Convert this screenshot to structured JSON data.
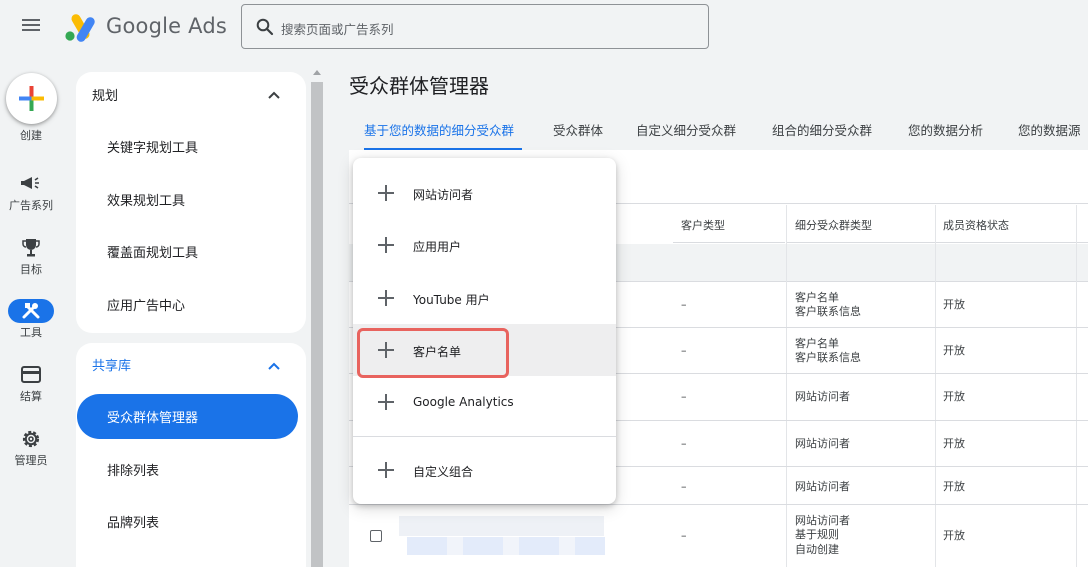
{
  "header": {
    "brand_name": "Google Ads",
    "search_placeholder": "搜索页面或广告系列"
  },
  "rail": {
    "create_label": "创建",
    "items": [
      {
        "label": "广告系列",
        "icon": "megaphone-icon"
      },
      {
        "label": "目标",
        "icon": "trophy-icon"
      },
      {
        "label": "工具",
        "icon": "tools-icon",
        "active": true
      },
      {
        "label": "结算",
        "icon": "credit-card-icon"
      },
      {
        "label": "管理员",
        "icon": "gear-icon"
      }
    ]
  },
  "sidebar": {
    "planning": {
      "title": "规划",
      "items": [
        "关键字规划工具",
        "效果规划工具",
        "覆盖面规划工具",
        "应用广告中心"
      ]
    },
    "shared_library": {
      "title": "共享库",
      "active_item": "受众群体管理器",
      "items": [
        "排除列表",
        "品牌列表"
      ]
    }
  },
  "page": {
    "title": "受众群体管理器",
    "tabs": [
      "基于您的数据的细分受众群",
      "受众群体",
      "自定义细分受众群",
      "组合的细分受众群",
      "您的数据分析",
      "您的数据源"
    ]
  },
  "table": {
    "columns": [
      "客户类型",
      "细分受众群类型",
      "成员资格状态"
    ],
    "rows": [
      {
        "customer_type": "–",
        "segment_type": [
          "客户名单",
          "客户联系信息"
        ],
        "status": "开放"
      },
      {
        "customer_type": "–",
        "segment_type": [
          "客户名单",
          "客户联系信息"
        ],
        "status": "开放"
      },
      {
        "customer_type": "–",
        "segment_type": [
          "网站访问者"
        ],
        "status": "开放"
      },
      {
        "customer_type": "–",
        "segment_type": [
          "网站访问者"
        ],
        "status": "开放"
      },
      {
        "customer_type": "–",
        "segment_type": [
          "网站访问者"
        ],
        "status": "开放"
      },
      {
        "customer_type": "–",
        "segment_type": [
          "网站访问者",
          "基于规则",
          "自动创建"
        ],
        "status": "开放"
      }
    ]
  },
  "dropdown_menu": {
    "items": [
      "网站访问者",
      "应用用户",
      "YouTube 用户",
      "客户名单",
      "Google Analytics"
    ],
    "highlighted_item": "客户名单",
    "footer_item": "自定义组合"
  },
  "colors": {
    "accent": "#1a73e8",
    "highlight_box": "#e8635e",
    "background": "#f1f3f4"
  }
}
